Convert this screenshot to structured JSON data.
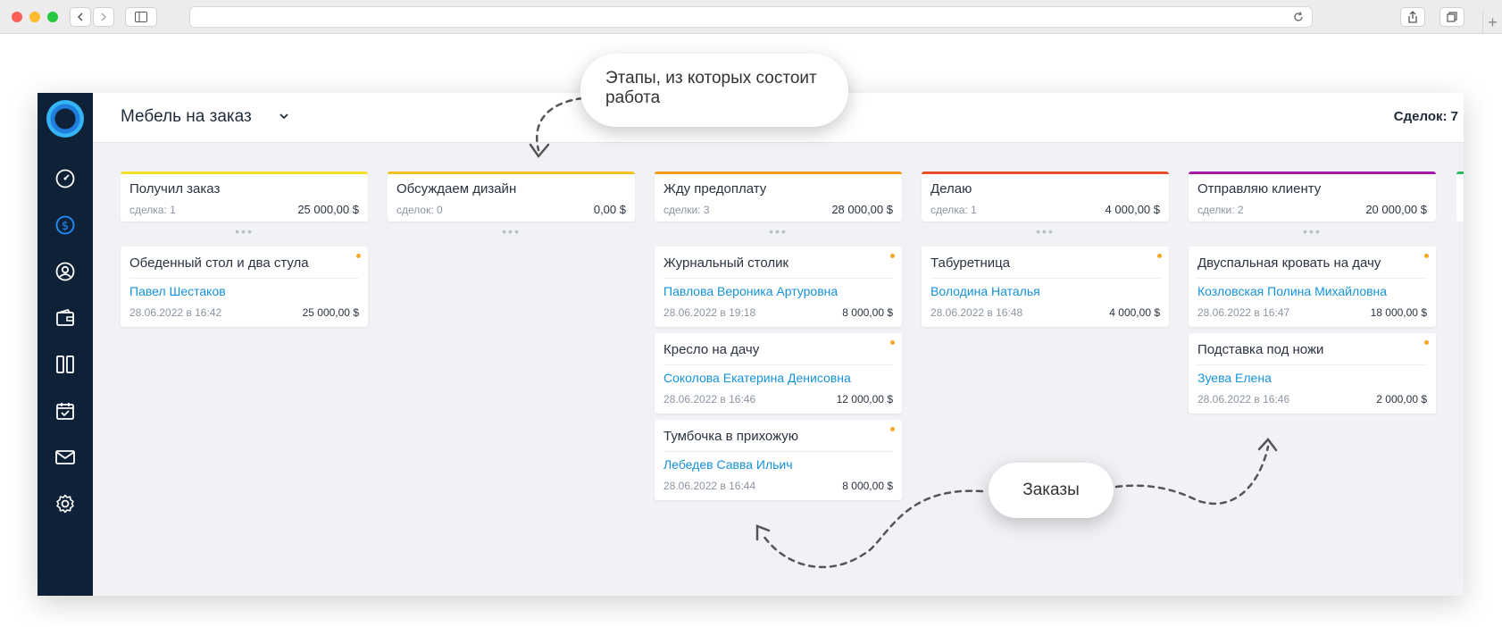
{
  "board": {
    "title": "Мебель на заказ",
    "deals_label": "Сделок: 7"
  },
  "callouts": {
    "stages": "Этапы, из которых состоит работа",
    "orders": "Заказы"
  },
  "sidebar_icons": [
    "dashboard-icon",
    "dollar-icon",
    "user-icon",
    "wallet-icon",
    "kanban-icon",
    "calendar-icon",
    "mail-icon",
    "settings-icon"
  ],
  "colors": {
    "sidebar_bg": "#0f2137",
    "active_icon": "#1e90ff",
    "client_link": "#1592d8",
    "card_dot": "#f5a623",
    "stage_colors": [
      "#f5e02a",
      "#f5c021",
      "#f39a1c",
      "#e94f28",
      "#a51ba8",
      "#2eb85c"
    ]
  },
  "columns": [
    {
      "name": "Получил заказ",
      "count": "сделка: 1",
      "sum": "25 000,00 $",
      "cards": [
        {
          "title": "Обеденный стол и два стула",
          "client": "Павел Шестаков",
          "date": "28.06.2022 в 16:42",
          "amount": "25 000,00 $"
        }
      ]
    },
    {
      "name": "Обсуждаем дизайн",
      "count": "сделок: 0",
      "sum": "0,00 $",
      "cards": []
    },
    {
      "name": "Жду предоплату",
      "count": "сделки: 3",
      "sum": "28 000,00 $",
      "cards": [
        {
          "title": "Журнальный столик",
          "client": "Павлова Вероника Артуровна",
          "date": "28.06.2022 в 19:18",
          "amount": "8 000,00 $"
        },
        {
          "title": "Кресло на дачу",
          "client": "Соколова Екатерина Денисовна",
          "date": "28.06.2022 в 16:46",
          "amount": "12 000,00 $"
        },
        {
          "title": "Тумбочка в прихожую",
          "client": "Лебедев Савва Ильич",
          "date": "28.06.2022 в 16:44",
          "amount": "8 000,00 $"
        }
      ]
    },
    {
      "name": "Делаю",
      "count": "сделка: 1",
      "sum": "4 000,00 $",
      "cards": [
        {
          "title": "Табуретница",
          "client": "Володина Наталья",
          "date": "28.06.2022 в 16:48",
          "amount": "4 000,00 $"
        }
      ]
    },
    {
      "name": "Отправляю клиенту",
      "count": "сделки: 2",
      "sum": "20 000,00 $",
      "cards": [
        {
          "title": "Двуспальная кровать на дачу",
          "client": "Козловская Полина Михайловна",
          "date": "28.06.2022 в 16:47",
          "amount": "18 000,00 $"
        },
        {
          "title": "Подставка под ножи",
          "client": "Зуева Елена",
          "date": "28.06.2022 в 16:46",
          "amount": "2 000,00 $"
        }
      ]
    }
  ]
}
